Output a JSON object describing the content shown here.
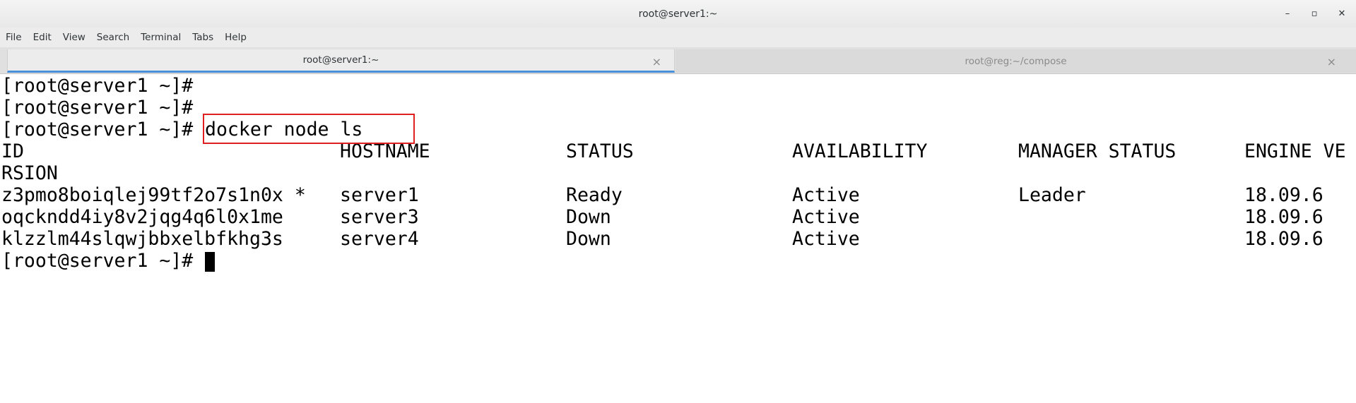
{
  "window": {
    "title": "root@server1:~",
    "controls": {
      "minimize": "–",
      "maximize": "▫",
      "close": "✕"
    }
  },
  "menu": [
    "File",
    "Edit",
    "View",
    "Search",
    "Terminal",
    "Tabs",
    "Help"
  ],
  "tabs": [
    {
      "label": "root@server1:~",
      "active": true
    },
    {
      "label": "root@reg:~/compose",
      "active": false
    }
  ],
  "tab_close_glyph": "×",
  "terminal": {
    "prompt_lines": [
      "[root@server1 ~]#",
      "[root@server1 ~]#",
      "[root@server1 ~]#"
    ],
    "command": "docker node ls",
    "headers": [
      "ID",
      "HOSTNAME",
      "STATUS",
      "AVAILABILITY",
      "MANAGER STATUS",
      "ENGINE VE"
    ],
    "header_wrap": "RSION",
    "rows": [
      [
        "z3pmo8boiqlej99tf2o7s1n0x *",
        "server1",
        "Ready",
        "Active",
        "Leader",
        "18.09.6"
      ],
      [
        "oqckndd4iy8v2jqg4q6l0x1me",
        "server3",
        "Down",
        "Active",
        "",
        "18.09.6"
      ],
      [
        "klzzlm44slqwjbbxelbfkhg3s",
        "server4",
        "Down",
        "Active",
        "",
        "18.09.6"
      ]
    ],
    "final_prompt": "[root@server1 ~]#"
  },
  "colors": {
    "highlight_border": "#e02020",
    "active_tab_underline": "#4a90d9",
    "terminal_bg": "#ffffff",
    "terminal_fg": "#000000"
  }
}
